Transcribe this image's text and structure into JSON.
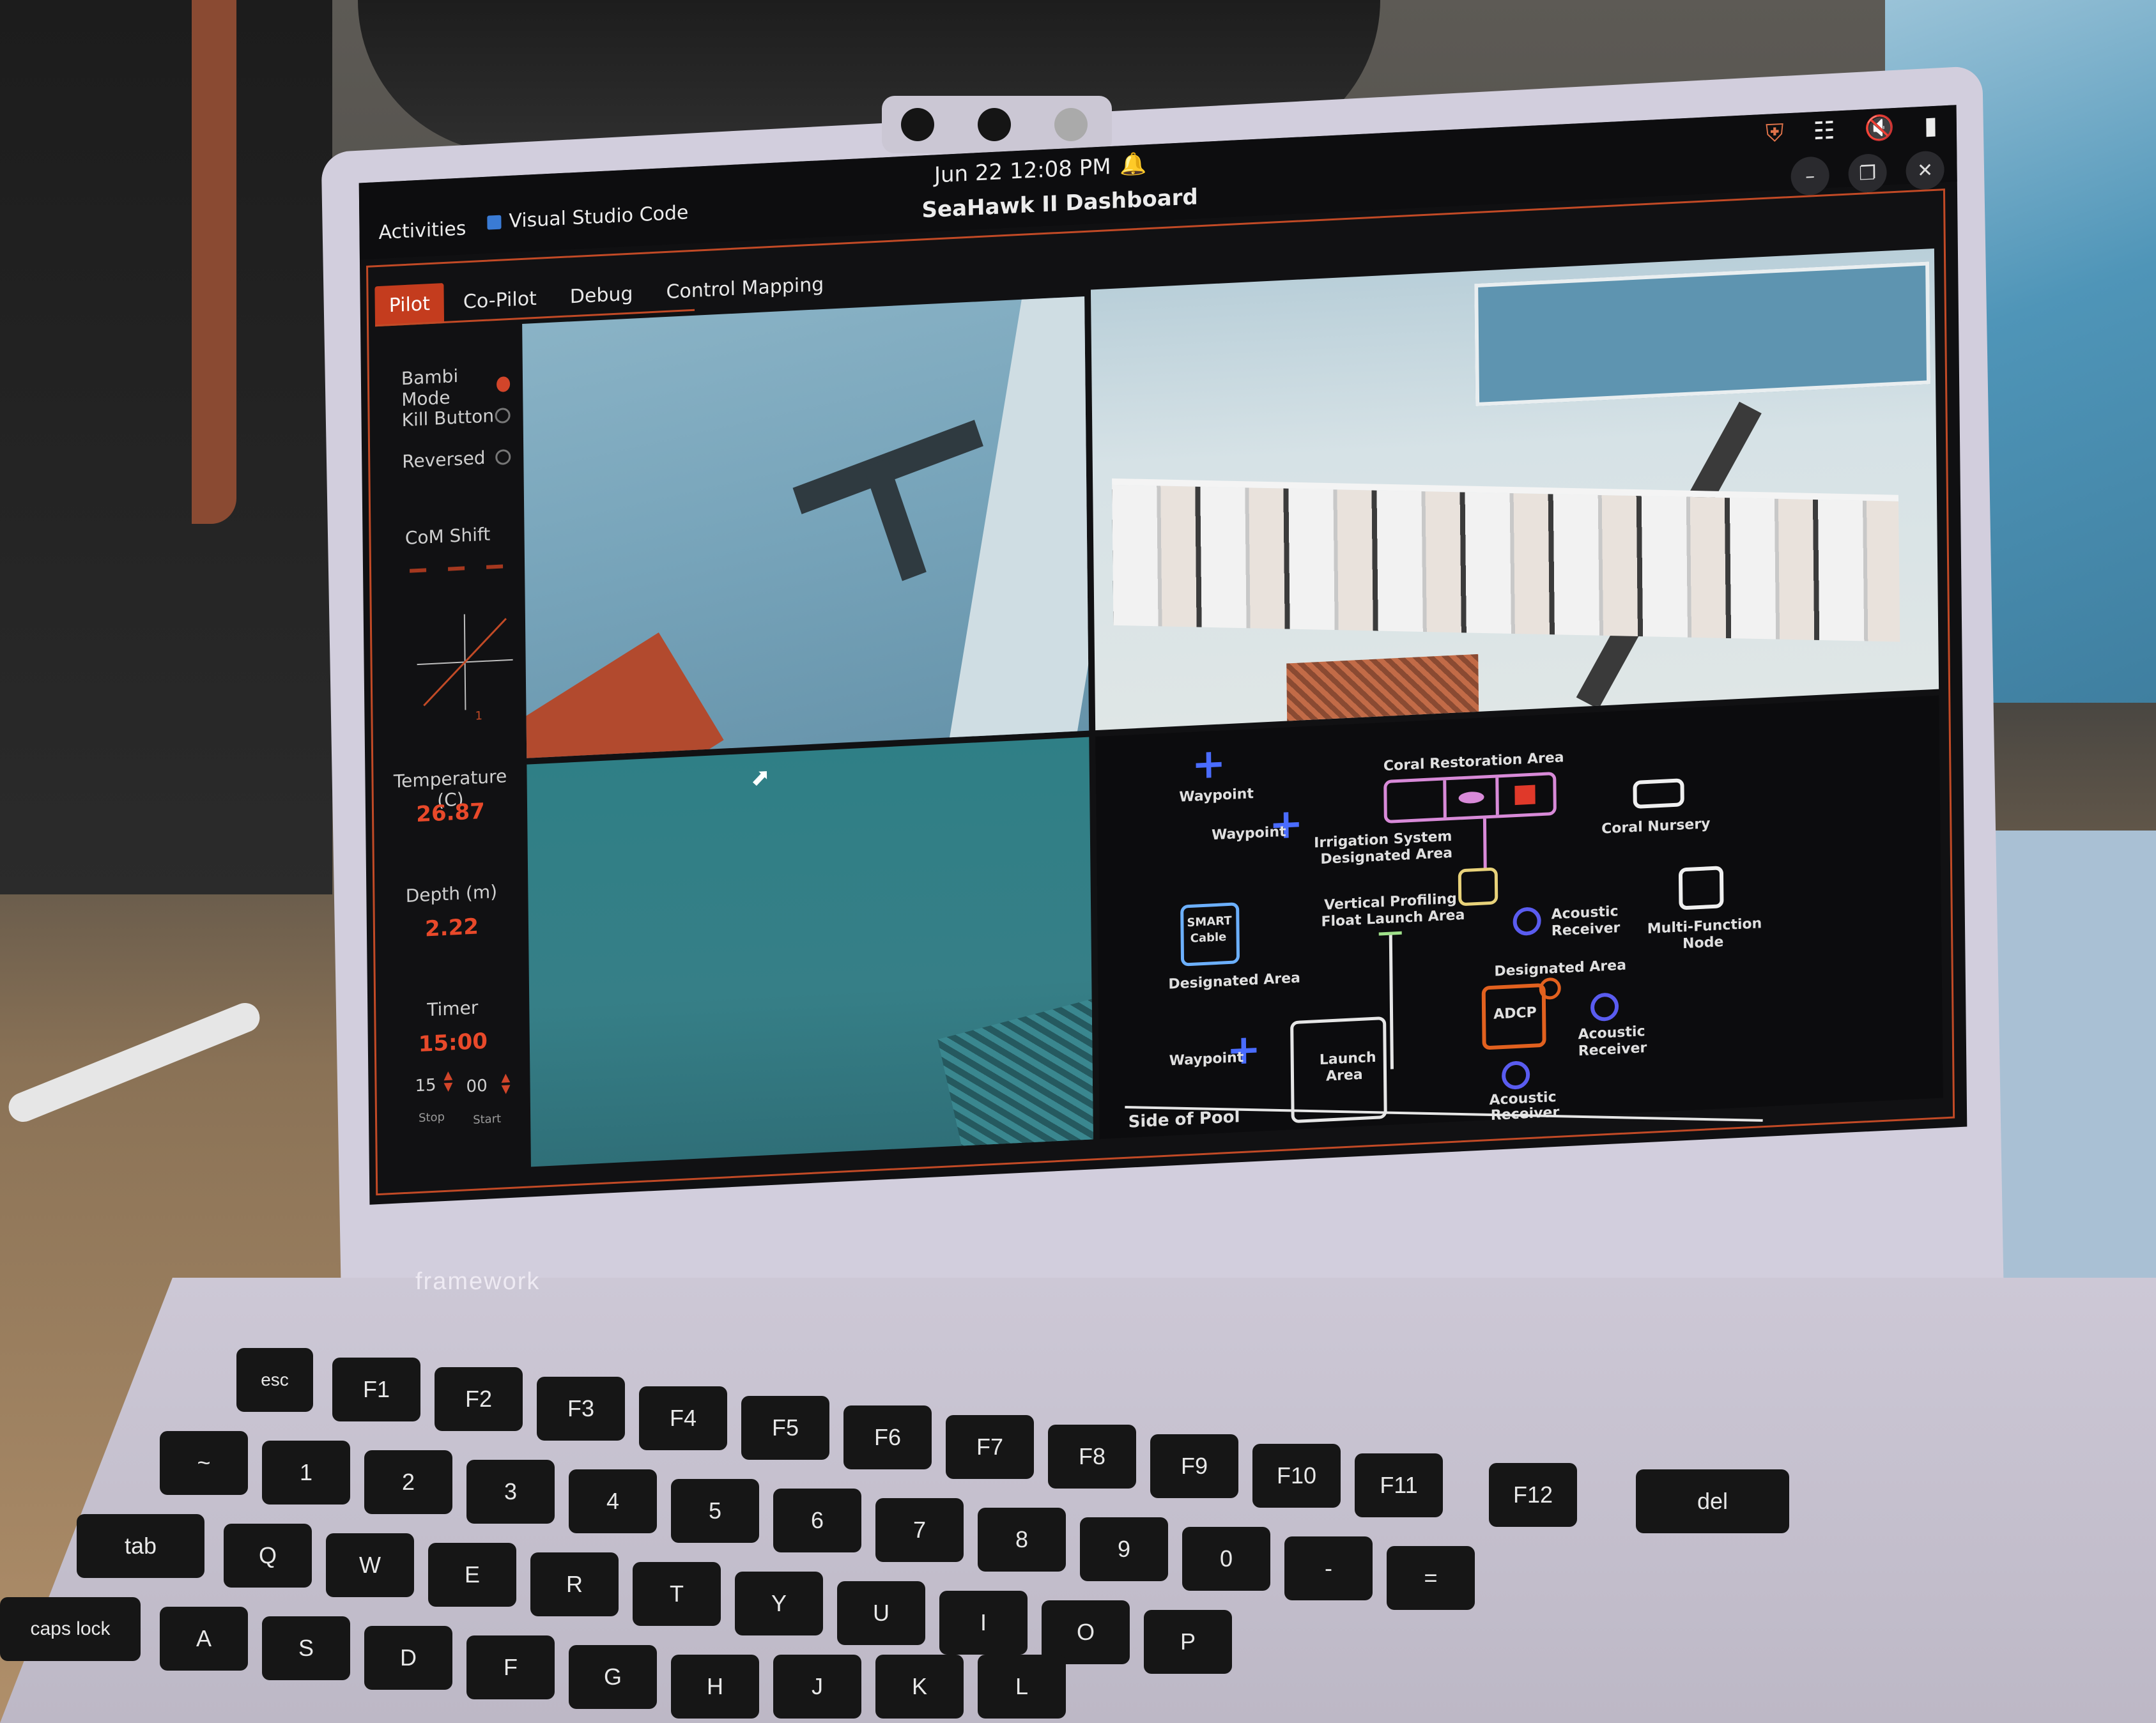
{
  "os": {
    "activities": "Activities",
    "focused_app": "Visual Studio Code",
    "clock": "Jun 22  12:08 PM",
    "window_title": "SeaHawk II Dashboard",
    "tray_icons": [
      "shield-alert-icon",
      "network-icon",
      "speaker-muted-icon",
      "battery-icon"
    ]
  },
  "tabs": [
    {
      "label": "Pilot",
      "active": true
    },
    {
      "label": "Co-Pilot",
      "active": false
    },
    {
      "label": "Debug",
      "active": false
    },
    {
      "label": "Control Mapping",
      "active": false
    }
  ],
  "left_panel": {
    "toggles": [
      {
        "label": "Bambi Mode",
        "on": true
      },
      {
        "label": "Kill Button",
        "on": false
      },
      {
        "label": "Reversed",
        "on": false
      }
    ],
    "com_shift_label": "CoM Shift",
    "crosshair_value": "1",
    "temperature_label": "Temperature (C)",
    "temperature_value": "26.87",
    "depth_label": "Depth (m)",
    "depth_value": "2.22",
    "timer_label": "Timer",
    "timer_value": "15:00",
    "timer_minutes": "15",
    "timer_seconds": "00",
    "stop_label": "Stop",
    "start_label": "Start"
  },
  "map": {
    "waypoint_label": "Waypoint",
    "coral_restoration": "Coral Restoration Area",
    "coral_nursery": "Coral Nursery",
    "irrigation_line1": "Irrigation System",
    "irrigation_line2": "Designated Area",
    "smart_cable_line1": "SMART",
    "smart_cable_line2": "Cable",
    "smart_designated": "Designated Area",
    "vertical_line1": "Vertical Profiling",
    "vertical_line2": "Float Launch Area",
    "acoustic_line1": "Acoustic",
    "acoustic_line2": "Receiver",
    "multi_line1": "Multi-Function",
    "multi_line2": "Node",
    "adcp_designated": "Designated Area",
    "adcp": "ADCP",
    "launch_line1": "Launch",
    "launch_line2": "Area",
    "side_of_pool": "Side of Pool"
  },
  "laptop": {
    "brand": "framework",
    "keys_row1": [
      "esc",
      "F1",
      "F2",
      "F3",
      "F4",
      "F5",
      "F6",
      "F7",
      "F8",
      "F9",
      "F10",
      "F11",
      "F12",
      "del"
    ],
    "keys_row2": [
      "~",
      "1",
      "2",
      "3",
      "4",
      "5",
      "6",
      "7",
      "8",
      "9",
      "0",
      "-",
      "="
    ],
    "keys_row3": [
      "tab",
      "Q",
      "W",
      "E",
      "R",
      "T",
      "Y",
      "U",
      "I",
      "O",
      "P"
    ],
    "keys_row4": [
      "caps lock",
      "A",
      "S",
      "D",
      "F",
      "G",
      "H",
      "J",
      "K",
      "L"
    ]
  },
  "colors": {
    "accent": "#c43c1e",
    "value": "#e8492a",
    "map_blue": "#4a6cff",
    "map_pink": "#d88ad8",
    "map_yellow": "#e8d27a",
    "map_orange": "#e2611f"
  }
}
